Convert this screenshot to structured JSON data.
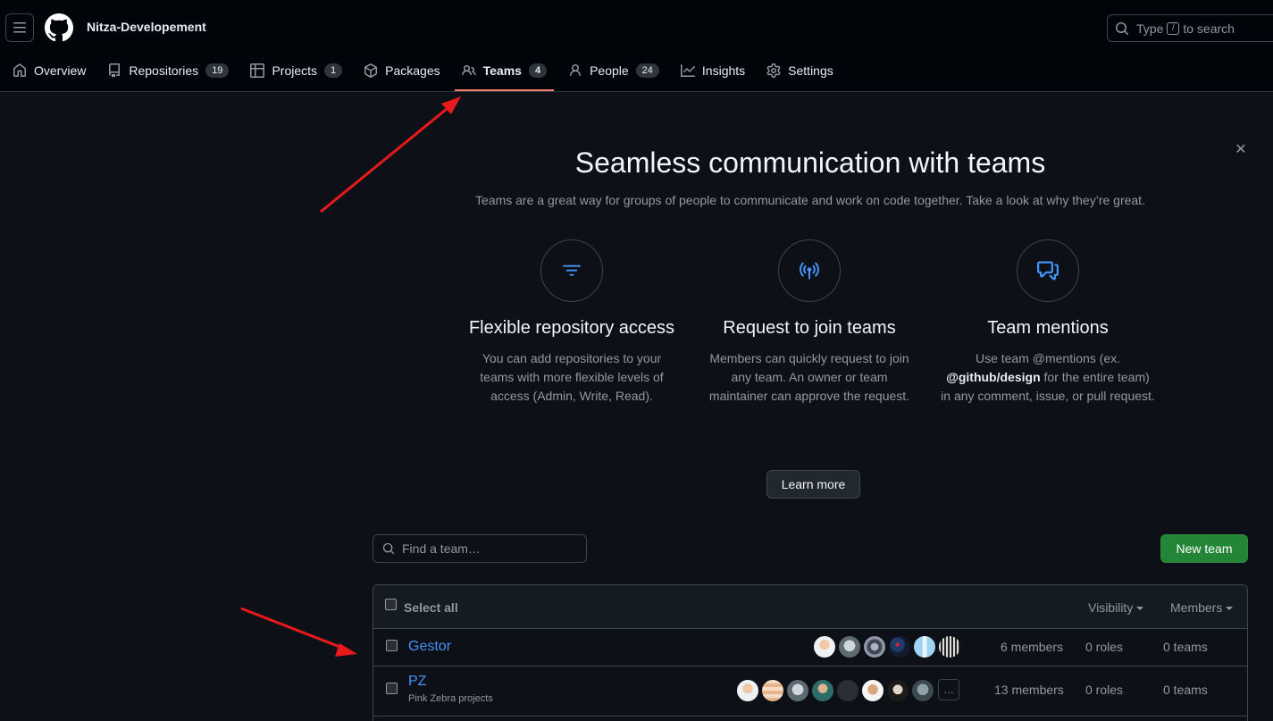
{
  "header": {
    "org_name": "Nitza-Developement",
    "search": {
      "prefix": "Type",
      "key": "/",
      "suffix": "to search"
    }
  },
  "nav": {
    "tabs": [
      {
        "label": "Overview",
        "icon": "home-icon"
      },
      {
        "label": "Repositories",
        "count": "19",
        "icon": "repo-icon"
      },
      {
        "label": "Projects",
        "count": "1",
        "icon": "table-icon"
      },
      {
        "label": "Packages",
        "icon": "package-icon"
      },
      {
        "label": "Teams",
        "count": "4",
        "icon": "people-icon",
        "selected": true
      },
      {
        "label": "People",
        "count": "24",
        "icon": "person-icon"
      },
      {
        "label": "Insights",
        "icon": "graph-icon"
      },
      {
        "label": "Settings",
        "icon": "gear-icon"
      }
    ]
  },
  "banner": {
    "title": "Seamless communication with teams",
    "subtitle": "Teams are a great way for groups of people to communicate and work on code together. Take a look at why they’re great.",
    "features": [
      {
        "title": "Flexible repository access",
        "description": "You can add repositories to your teams with more flexible levels of access (Admin, Write, Read).",
        "icon": "filter-icon"
      },
      {
        "title": "Request to join teams",
        "description": "Members can quickly request to join any team. An owner or team maintainer can approve the request.",
        "icon": "broadcast-icon"
      },
      {
        "title": "Team mentions",
        "desc_pre": "Use team @mentions (ex.",
        "desc_bold": "@github/design",
        "desc_post": "for the entire team) in any comment, issue, or pull request.",
        "icon": "comment-discussion-icon"
      }
    ],
    "learn_more": "Learn more"
  },
  "teams": {
    "search_placeholder": "Find a team…",
    "new_team": "New team",
    "select_all": "Select all",
    "visibility": "Visibility",
    "members": "Members",
    "rows": [
      {
        "name": "Gestor",
        "description": "",
        "members": "6 members",
        "roles": "0 roles",
        "teams": "0 teams"
      },
      {
        "name": "PZ",
        "description": "Pink Zebra projects",
        "members": "13 members",
        "roles": "0 roles",
        "teams": "0 teams",
        "more": "…"
      }
    ]
  },
  "colors": {
    "accent_link": "#4493f8",
    "primary_button": "#238636",
    "selected_tab_underline": "#f78166",
    "annotation_arrow": "#e8191b"
  }
}
